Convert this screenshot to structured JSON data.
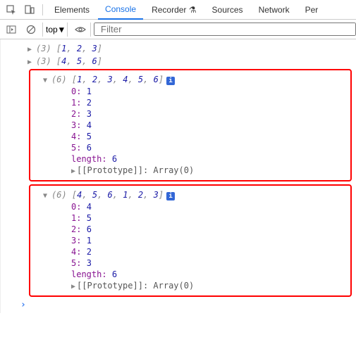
{
  "tabs": {
    "elements": "Elements",
    "console": "Console",
    "recorder": "Recorder",
    "sources": "Sources",
    "network": "Network",
    "performance": "Per"
  },
  "toolbar": {
    "scope": "top",
    "filter_placeholder": "Filter"
  },
  "console": {
    "rows": [
      {
        "expanded": false,
        "count": 3,
        "preview": [
          1,
          2,
          3
        ]
      },
      {
        "expanded": false,
        "count": 3,
        "preview": [
          4,
          5,
          6
        ]
      }
    ],
    "blocks": [
      {
        "count": 6,
        "preview": [
          1,
          2,
          3,
          4,
          5,
          6
        ],
        "entries": [
          {
            "idx": "0",
            "val": 1
          },
          {
            "idx": "1",
            "val": 2
          },
          {
            "idx": "2",
            "val": 3
          },
          {
            "idx": "3",
            "val": 4
          },
          {
            "idx": "4",
            "val": 5
          },
          {
            "idx": "5",
            "val": 6
          }
        ],
        "length_key": "length",
        "length_val": 6,
        "prototype": "[[Prototype]]: Array(0)"
      },
      {
        "count": 6,
        "preview": [
          4,
          5,
          6,
          1,
          2,
          3
        ],
        "entries": [
          {
            "idx": "0",
            "val": 4
          },
          {
            "idx": "1",
            "val": 5
          },
          {
            "idx": "2",
            "val": 6
          },
          {
            "idx": "3",
            "val": 1
          },
          {
            "idx": "4",
            "val": 2
          },
          {
            "idx": "5",
            "val": 3
          }
        ],
        "length_key": "length",
        "length_val": 6,
        "prototype": "[[Prototype]]: Array(0)"
      }
    ]
  },
  "info_badge": "i",
  "prompt": "›"
}
